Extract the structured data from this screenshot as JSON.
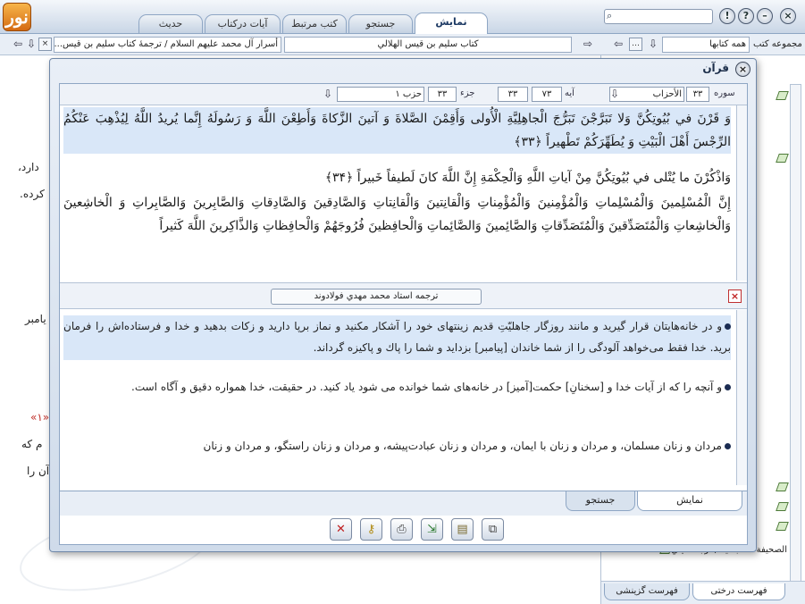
{
  "app": {
    "logo_text": "نور"
  },
  "top_tabs": [
    {
      "label": "نمایش",
      "active": true
    },
    {
      "label": "جستجو",
      "active": false
    },
    {
      "label": "کتب مرتبط",
      "active": false
    },
    {
      "label": "آیات درکتاب",
      "active": false
    },
    {
      "label": "حدیث",
      "active": false
    }
  ],
  "address": {
    "collection_label": "مجموعه کتب",
    "collection_value": "همه کتابها",
    "book_value": "کتاب سليم بن قيس الهلالي",
    "path_value": "أسرار آل محمد عليهم السلام / ترجمهٔ كتاب سليم بن قيس..."
  },
  "background_doc": {
    "fragments": [
      "دارد،",
      "کرده.",
      "یامبر",
      "«۱»",
      "م که",
      "آن را"
    ]
  },
  "right_panel": {
    "items": [
      "",
      "",
      "",
      "",
      "",
      "الصحيفة السجادية / ترجمة آيتي"
    ],
    "bottom_tabs": [
      {
        "label": "فهرست درختی",
        "active": true
      },
      {
        "label": "فهرست گزینشی",
        "active": false
      }
    ]
  },
  "dialog": {
    "title": "قرآن",
    "nav": {
      "sura_label": "سوره",
      "sura_number": "۳۳",
      "sura_name": "الأحزاب",
      "aya_label": "آیه",
      "aya_value": "۷۳",
      "aya_total": "۳۳",
      "juz_label": "جزء",
      "juz_value": "۳۳",
      "hizb_value": "حزب ۱"
    },
    "verses": [
      {
        "text": "وَ قَرْنَ في‏ بُيُوتِكُنَّ وَلا تَبَرَّجْنَ تَبَرُّجَ الْجاهِلِيَّةِ الْأُولى‏ وَأَقِمْنَ الصَّلاةَ وَ آتينَ الزَّكاةَ وَأَطِعْنَ اللَّهَ وَ رَسُولَهُ إِنَّما يُريدُ اللَّهُ لِيُذْهِبَ عَنْكُمُ الرِّجْسَ أَهْلَ الْبَيْتِ وَ يُطَهِّرَكُمْ تَطْهيراً ﴿۳۳﴾",
        "highlighted": true
      },
      {
        "text": "وَاذْكُرْنَ ما يُتْلى‏ في‏ بُيُوتِكُنَّ مِنْ آياتِ اللَّهِ وَالْحِكْمَةِ إِنَّ اللَّهَ كانَ لَطيفاً خَبيراً ﴿۳۴﴾",
        "highlighted": false
      },
      {
        "text": "إِنَّ الْمُسْلِمينَ وَالْمُسْلِماتِ وَالْمُؤْمِنينَ وَالْمُؤْمِناتِ وَالْقانِتينَ وَالْقانِتاتِ وَالصَّادِقينَ وَالصَّادِقاتِ وَالصَّابِرينَ وَالصَّابِراتِ وَ الْخاشِعينَ وَالْخاشِعاتِ وَالْمُتَصَدِّقينَ وَالْمُتَصَدِّقاتِ وَالصَّائِمينَ وَالصَّائِماتِ وَالْحافِظينَ فُرُوجَهُمْ وَالْحافِظاتِ وَالذَّاكِرينَ اللَّهَ كَثيراً",
        "highlighted": false
      }
    ],
    "translator": "ترجمه استاد محمد مهدي فولادوند",
    "translations": [
      {
        "text": "و در خانه‌هايتان قرار گيريد و مانند روزگار جاهليّتِ قديم زينتهاى خود را آشكار مكنيد و نماز برپا داريد و زكات بدهيد و خدا و فرستاده‌اش را فرمان بريد. خدا فقط مى‌خواهد آلودگى را از شما خاندان [پيامبر] بزدايد و شما را پاك و پاكيزه گرداند.",
        "highlighted": true
      },
      {
        "text": "و آنچه را كه از آيات خدا و [سخنانِ] حكمت[آميز] در خانه‌هاى شما خوانده مى شود ياد كنيد. در حقيقت، خدا همواره دقيق و آگاه است.",
        "highlighted": false
      },
      {
        "text": "مردان و زنان مسلمان، و مردان و زنان با ايمان، و مردان و زنان عبادت‌پيشه، و مردان و زنان راستگو، و مردان و زنان",
        "highlighted": false
      }
    ],
    "bottom_tabs": [
      {
        "label": "نمایش",
        "active": true
      },
      {
        "label": "جستجو",
        "active": false
      }
    ]
  }
}
